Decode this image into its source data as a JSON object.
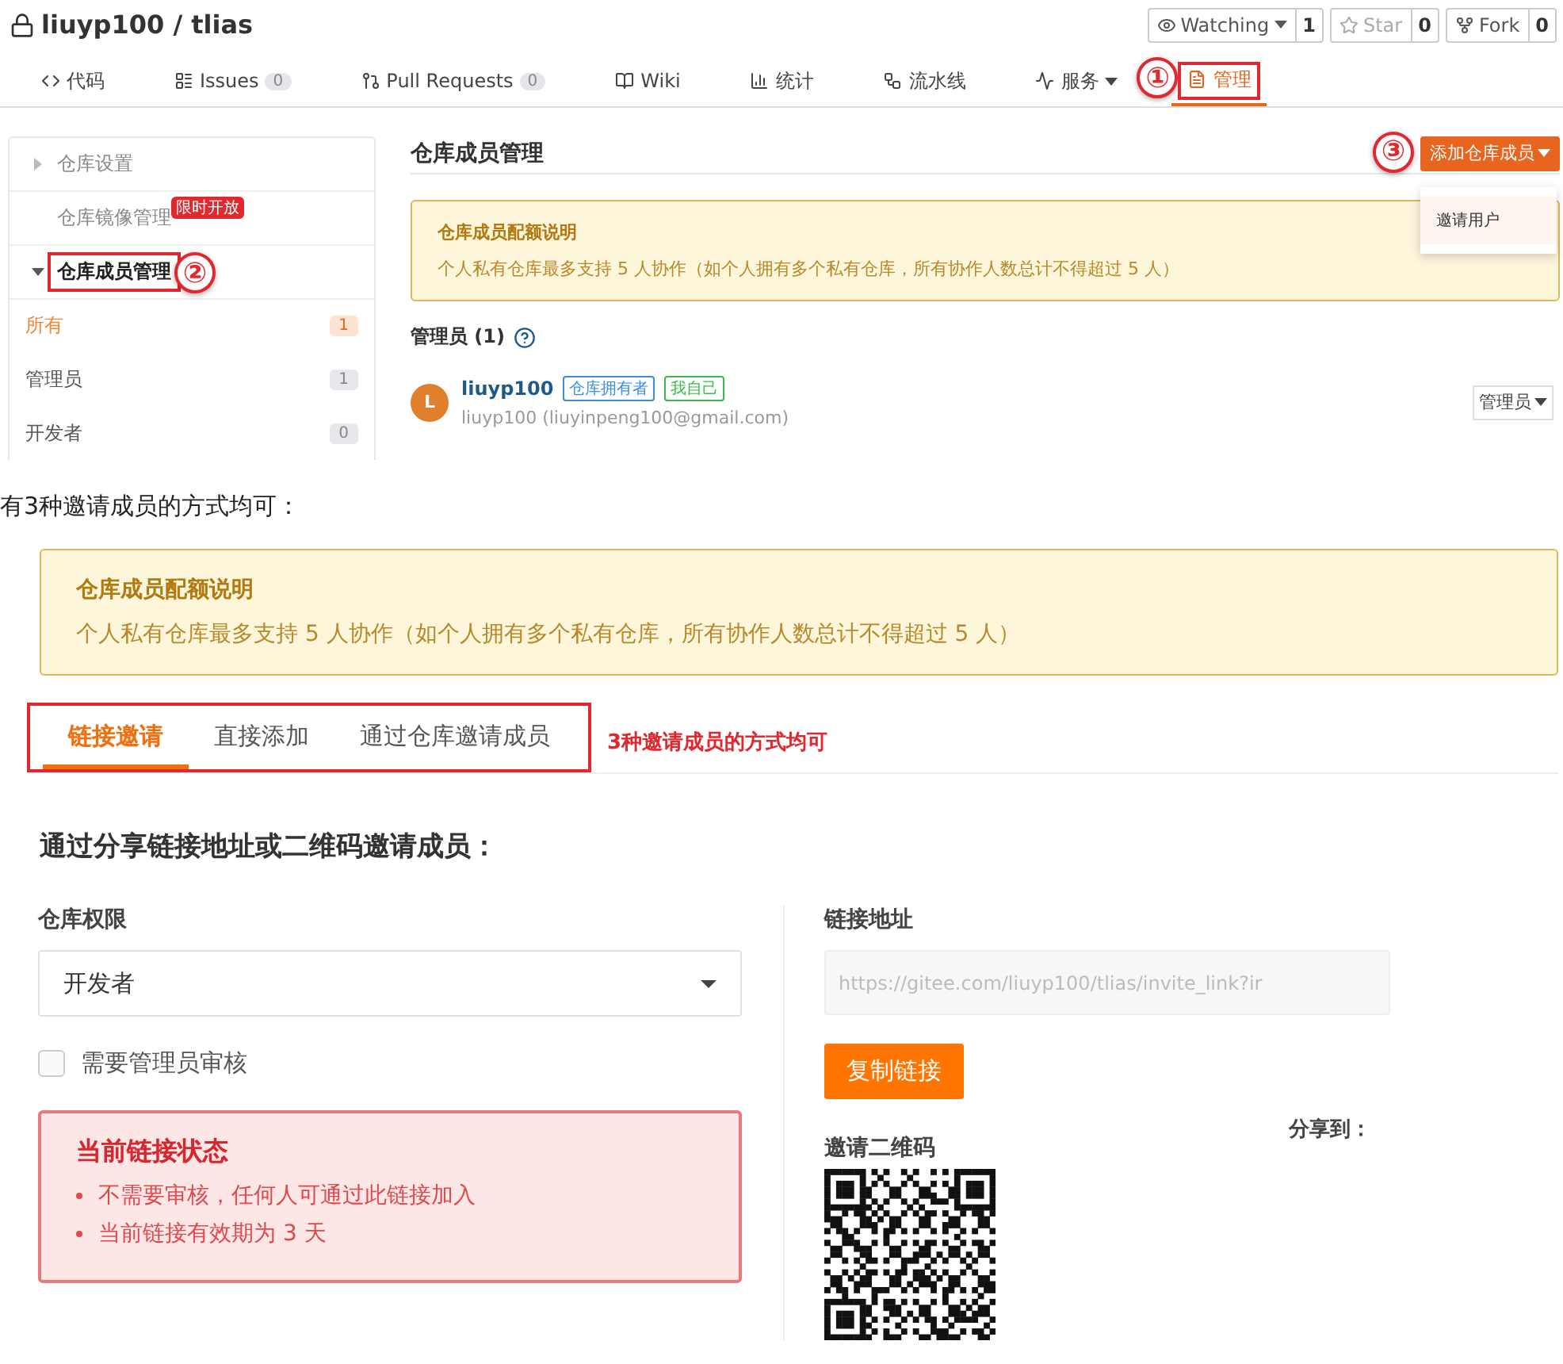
{
  "repo": {
    "title": "liuyp100 / tlias",
    "actions": [
      {
        "label": "Watching",
        "count": "1",
        "disabled": false
      },
      {
        "label": "Star",
        "count": "0",
        "disabled": true
      },
      {
        "label": "Fork",
        "count": "0",
        "disabled": false
      }
    ]
  },
  "nav_tabs": [
    {
      "label": "代码",
      "selected": false
    },
    {
      "label": "Issues",
      "count": "0",
      "selected": false
    },
    {
      "label": "Pull Requests",
      "count": "0",
      "selected": false
    },
    {
      "label": "Wiki",
      "selected": false
    },
    {
      "label": "统计",
      "selected": false
    },
    {
      "label": "流水线",
      "selected": false
    },
    {
      "label": "服务",
      "selected": false
    },
    {
      "label": "管理",
      "selected": true,
      "boxed": true,
      "marker": "①"
    }
  ],
  "sidebar": {
    "items": [
      {
        "kind": "group",
        "label": "仓库设置",
        "expanded": false
      },
      {
        "kind": "link",
        "label": "仓库镜像管理",
        "badge": "限时开放"
      },
      {
        "kind": "group",
        "label": "仓库成员管理",
        "expanded": true,
        "boxed": true,
        "marker": "②",
        "children": [
          {
            "label": "所有",
            "count": "1",
            "selected": true
          },
          {
            "label": "管理员",
            "count": "1",
            "selected": false
          },
          {
            "label": "开发者",
            "count": "0",
            "selected": false
          }
        ]
      }
    ]
  },
  "members": {
    "title": "仓库成员管理",
    "add_button": {
      "label": "添加仓库成员",
      "marker": "③"
    },
    "dropdown_menu": [
      "邀请用户"
    ],
    "notice": {
      "title": "仓库成员配额说明",
      "text": "个人私有仓库最多支持 5 人协作（如个人拥有多个私有仓库，所有协作人数总计不得超过 5 人）"
    },
    "admins_heading": "管理员 (1)",
    "member": {
      "avatar": "L",
      "name": "liuyp100",
      "tags": [
        {
          "label": "仓库拥有者",
          "color": "#3a8ee6"
        },
        {
          "label": "我自己",
          "color": "#3cb94a"
        }
      ],
      "detail": "liuyp100 (liuyinpeng100@gmail.com)",
      "role": "管理员"
    }
  },
  "caption": "有3种邀请成员的方式均可：",
  "invite": {
    "notice": {
      "title": "仓库成员配额说明",
      "text": "个人私有仓库最多支持 5 人协作（如个人拥有多个私有仓库，所有协作人数总计不得超过 5 人）"
    },
    "tabs": [
      {
        "label": "链接邀请",
        "selected": true
      },
      {
        "label": "直接添加",
        "selected": false
      },
      {
        "label": "通过仓库邀请成员",
        "selected": false
      }
    ],
    "tabs_note": "3种邀请成员的方式均可",
    "heading": "通过分享链接地址或二维码邀请成员：",
    "permission": {
      "label": "仓库权限",
      "value": "开发者"
    },
    "review": {
      "label": "需要管理员审核",
      "checked": false
    },
    "status": {
      "title": "当前链接状态",
      "items": [
        "不需要审核，任何人可通过此链接加入",
        "当前链接有效期为 3 天"
      ]
    },
    "link": {
      "label": "链接地址",
      "value": "https://gitee.com/liuyp100/tlias/invite_link?ir"
    },
    "copy_button": "复制链接",
    "qr_label": "邀请二维码",
    "share_label": "分享到："
  }
}
